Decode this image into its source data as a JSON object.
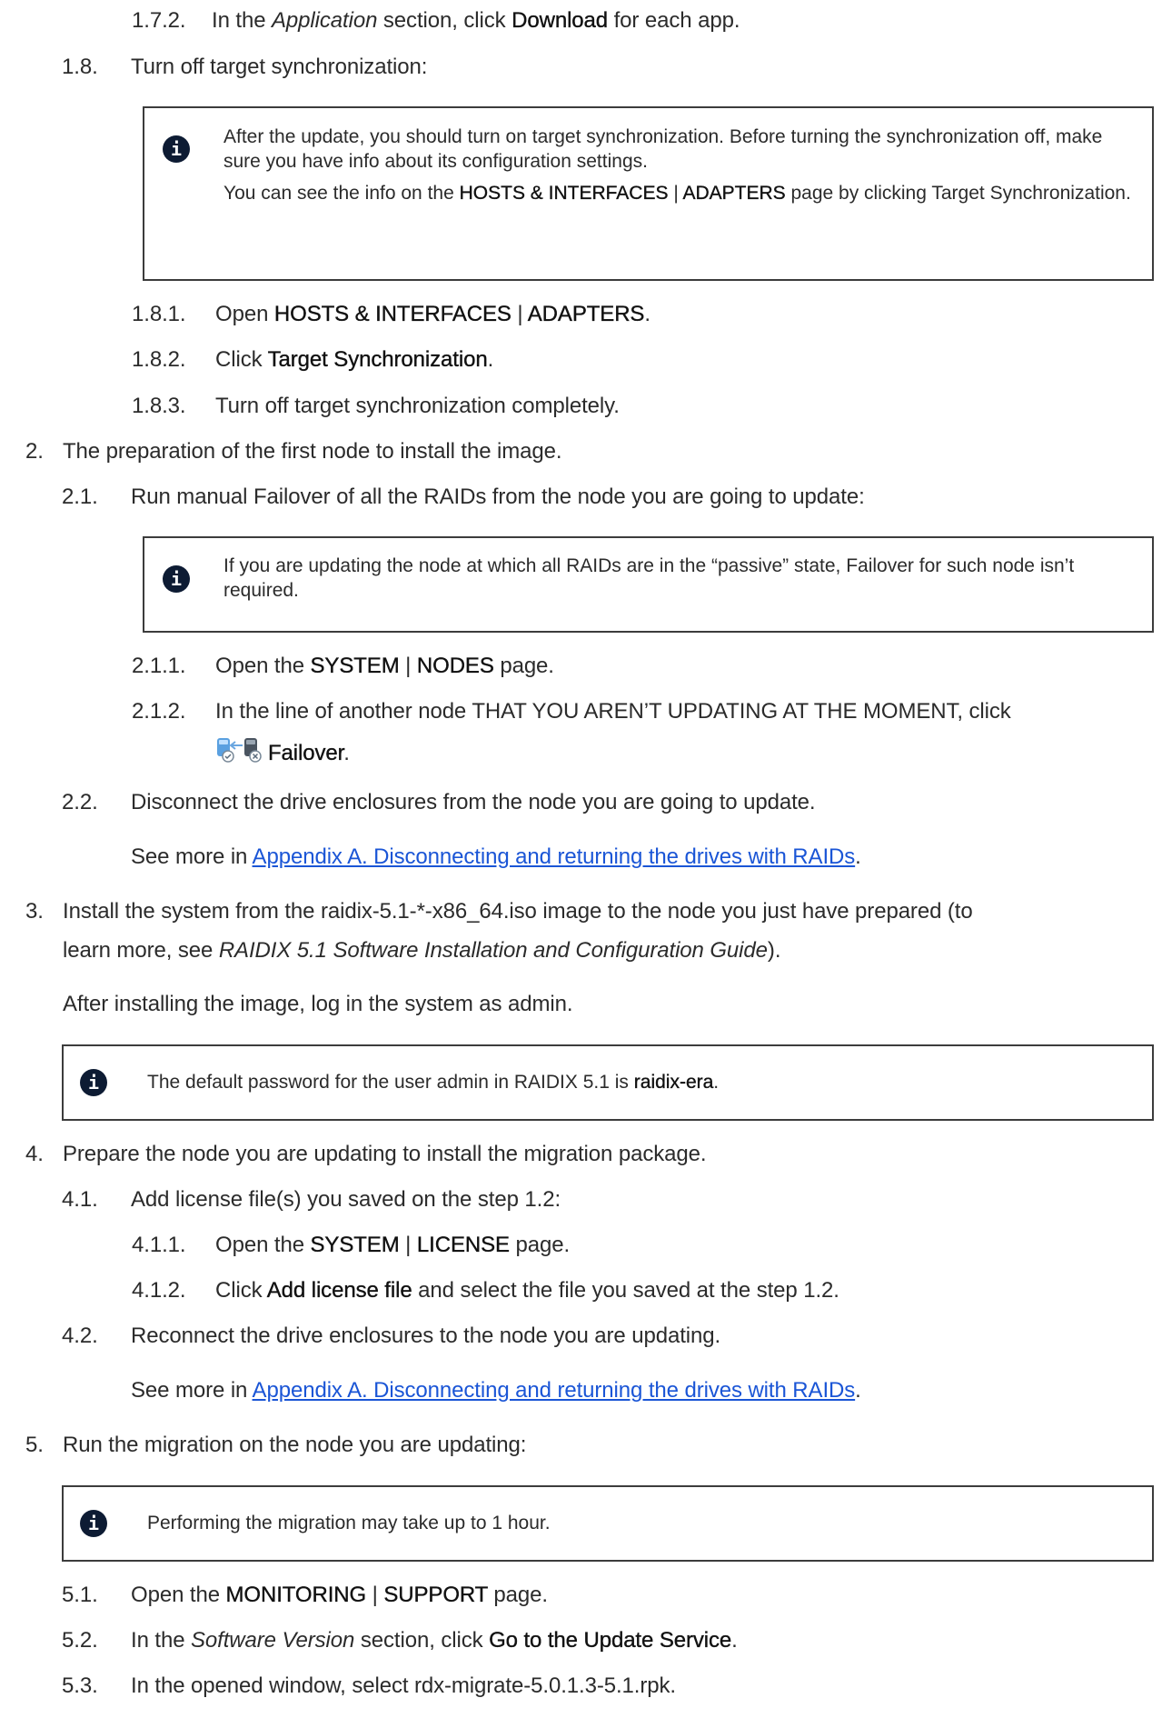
{
  "s172": {
    "num": "1.7.2.",
    "t1": "In the ",
    "i1": "Application",
    "t2": " section, click ",
    "b1": "Download",
    "t3": " for each app."
  },
  "s18": {
    "num": "1.8.",
    "text": "Turn off target synchronization:"
  },
  "note1": {
    "icon": "i",
    "p1": "After the update, you should turn on target synchronization. Before turning the synchronization off, make sure you have info about its configuration settings.",
    "p2a": "You can see the info on the ",
    "p2b1": "HOSTS & INTERFACES",
    "p2sep": " | ",
    "p2b2": "ADAPTERS",
    "p2c": " page by clicking Target Synchronization."
  },
  "s181": {
    "num": "1.8.1.",
    "t1": "Open ",
    "b1": "HOSTS & INTERFACES",
    "sep": " | ",
    "b2": "ADAPTERS",
    "t2": "."
  },
  "s182": {
    "num": "1.8.2.",
    "t1": "Click ",
    "b1": "Target Synchronization",
    "t2": "."
  },
  "s183": {
    "num": "1.8.3.",
    "text": "Turn off target synchronization completely."
  },
  "s2": {
    "num": "2.",
    "text": "The preparation of the first node to install the image."
  },
  "s21": {
    "num": "2.1.",
    "text": "Run manual Failover of all the RAIDs from the node you are going to update:"
  },
  "note2": {
    "icon": "i",
    "text": "If you are updating the node at which all RAIDs are in the “passive” state, Failover for such node isn’t required."
  },
  "s211": {
    "num": "2.1.1.",
    "t1": "Open the ",
    "b1": "SYSTEM",
    "sep": " | ",
    "b2": "NODES",
    "t2": " page."
  },
  "s212": {
    "num": "2.1.2.",
    "text": "In the line of another node THAT YOU AREN’T UPDATING AT THE MOMENT, click",
    "b1": "Failover",
    "t2": "."
  },
  "s22": {
    "num": "2.2.",
    "text": "Disconnect the drive enclosures from the node you are going to update."
  },
  "s22see": {
    "t1": "See more in ",
    "link": "Appendix A. Disconnecting and returning the drives with RAIDs",
    "t2": "."
  },
  "s3": {
    "num": "3.",
    "line1": "Install the system from the raidix-5.1-*-x86_64.iso image to the node you just have prepared (to",
    "t1": "learn more, see ",
    "i1": "RAIDIX 5.1 Software Installation and Configuration Guide",
    "t2": ")."
  },
  "s3after": {
    "text": "After installing the image, log in the system as admin."
  },
  "note3": {
    "icon": "i",
    "t1": "The default password for the user admin in RAIDIX 5.1 is ",
    "b1": "raidix-era",
    "t2": "."
  },
  "s4": {
    "num": "4.",
    "text": "Prepare the node you are updating to install the migration package."
  },
  "s41": {
    "num": "4.1.",
    "text": "Add license file(s) you saved on the step 1.2:"
  },
  "s411": {
    "num": "4.1.1.",
    "t1": "Open the ",
    "b1": "SYSTEM",
    "sep": " | ",
    "b2": "LICENSE",
    "t2": " page."
  },
  "s412": {
    "num": "4.1.2.",
    "t1": "Click ",
    "b1": "Add license file",
    "t2": " and select the file you saved at the step 1.2."
  },
  "s42": {
    "num": "4.2.",
    "text": "Reconnect the drive enclosures to the node you are updating."
  },
  "s42see": {
    "t1": "See more in ",
    "link": "Appendix A. Disconnecting and returning the drives with RAIDs",
    "t2": "."
  },
  "s5": {
    "num": "5.",
    "text": "Run the migration on the node you are updating:"
  },
  "note4": {
    "icon": "i",
    "text": "Performing the migration may take up to 1 hour."
  },
  "s51": {
    "num": "5.1.",
    "t1": "Open the ",
    "b1": "MONITORING",
    "sep": " | ",
    "b2": "SUPPORT",
    "t2": " page."
  },
  "s52": {
    "num": "5.2.",
    "t1": "In the ",
    "i1": "Software Version",
    "t2": " section, click ",
    "b1": "Go to the Update Service",
    "t3": "."
  },
  "s53": {
    "num": "5.3.",
    "text": "In the opened window, select rdx-migrate-5.0.1.3-5.1.rpk."
  }
}
